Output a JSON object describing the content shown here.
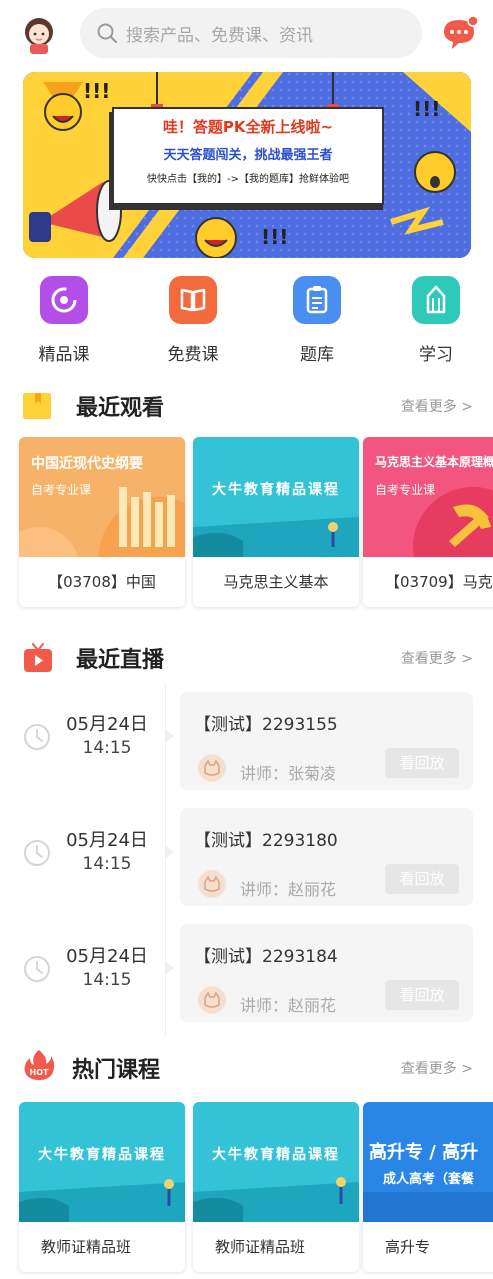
{
  "search": {
    "placeholder": "搜索产品、免费课、资讯"
  },
  "banner": {
    "line1": "哇！答题PK全新上线啦~",
    "line2": "天天答题闯关，挑战最强王者",
    "line3": "快快点击【我的】->【我的题库】抢鲜体验吧",
    "deco": "!!!"
  },
  "nav": [
    {
      "label": "精品课",
      "icon": "boutique-course-icon",
      "color": "#b34fe8"
    },
    {
      "label": "免费课",
      "icon": "free-course-book-icon",
      "color": "#f26a3d"
    },
    {
      "label": "题库",
      "icon": "question-bank-clipboard-icon",
      "color": "#4a8ff0"
    },
    {
      "label": "学习",
      "icon": "study-pencil-icon",
      "color": "#2ec9b8"
    }
  ],
  "recent": {
    "title": "最近观看",
    "more": "查看更多 >",
    "items": [
      {
        "thumb_title": "中国近现代史纲要",
        "thumb_sub": "自考专业课",
        "caption": "【03708】中国",
        "color": "#f7b26a"
      },
      {
        "thumb_title": "大牛教育精品课程",
        "thumb_sub": "",
        "caption": "马克思主义基本",
        "color": "#33c2d6"
      },
      {
        "thumb_title": "马克思主义基本原理概论",
        "thumb_sub": "自考专业课",
        "caption": "【03709】马克",
        "color": "#f2557d"
      }
    ]
  },
  "live": {
    "title": "最近直播",
    "more": "查看更多 >",
    "items": [
      {
        "date": "05月24日",
        "time": "14:15",
        "title": "【测试】2293155",
        "teacher": "讲师：张菊凌",
        "button": "看回放"
      },
      {
        "date": "05月24日",
        "time": "14:15",
        "title": "【测试】2293180",
        "teacher": "讲师：赵丽花",
        "button": "看回放"
      },
      {
        "date": "05月24日",
        "time": "14:15",
        "title": "【测试】2293184",
        "teacher": "讲师：赵丽花",
        "button": "看回放"
      }
    ]
  },
  "hot": {
    "title": "热门课程",
    "badge": "HOT",
    "more": "查看更多 >",
    "items": [
      {
        "thumb_title": "大牛教育精品课程",
        "caption": "教师证精品班"
      },
      {
        "thumb_title": "大牛教育精品课程",
        "caption": "教师证精品班"
      },
      {
        "thumb_title": "高升专 / 高升",
        "thumb_sub": "成人高考（套餐",
        "caption": "高升专"
      }
    ]
  },
  "colors": {
    "accent": "#f15a4a",
    "muted": "#999999",
    "panel": "#f5f5f5"
  }
}
